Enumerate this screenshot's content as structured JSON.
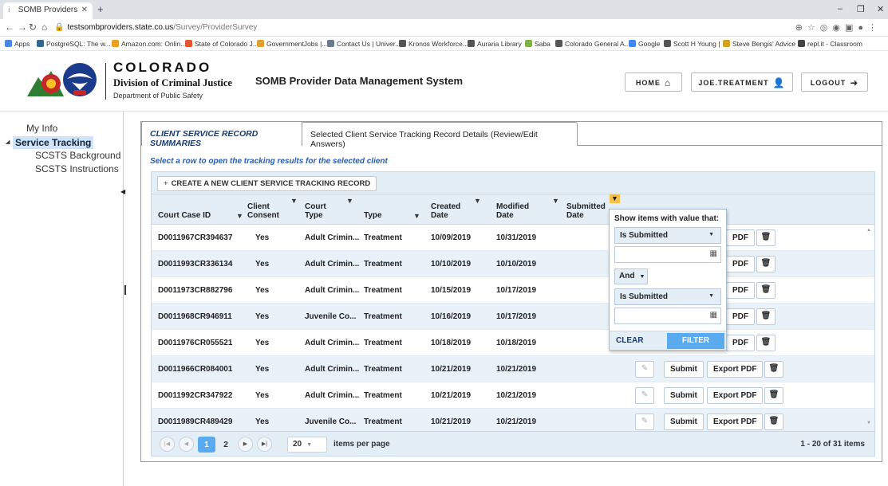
{
  "browser": {
    "tab_title": "SOMB Providers",
    "url_host": "testsombproviders.state.co.us",
    "url_path": "/Survey/ProviderSurvey",
    "bookmarks": [
      "Apps",
      "PostgreSQL: The w...",
      "Amazon.com: Onlin...",
      "State of Colorado J...",
      "GovernmentJobs |...",
      "Contact Us | Univer...",
      "Kronos Workforce...",
      "Auraria Library",
      "Saba",
      "Colorado General A...",
      "Google",
      "Scott H Young |",
      "Steve Bengis' Advice",
      "repl.it - Classroom"
    ]
  },
  "header": {
    "state": "COLORADO",
    "division": "Division of Criminal Justice",
    "department": "Department of Public Safety",
    "logo_text": "CDPS",
    "system_title": "SOMB Provider Data Management System",
    "home_label": "HOME",
    "user_label": "JOE.TREATMENT",
    "logout_label": "LOGOUT"
  },
  "sidebar": {
    "items": [
      "My Info",
      "Service Tracking",
      "SCSTS Background",
      "SCSTS Instructions"
    ]
  },
  "tabs": [
    "CLIENT SERVICE RECORD SUMMARIES",
    "Selected Client Service Tracking Record Details (Review/Edit Answers)"
  ],
  "instruction": "Select a row to open the tracking results for the selected client",
  "grid": {
    "create_label": "CREATE A NEW CLIENT SERVICE TRACKING RECORD",
    "columns": [
      "Court Case ID",
      "Client Consent",
      "Court Type",
      "Type",
      "Created Date",
      "Modified Date",
      "Submitted Date"
    ],
    "rows": [
      [
        "D0011967CR394637",
        "Yes",
        "Adult Crimin...",
        "Treatment",
        "10/09/2019",
        "10/31/2019"
      ],
      [
        "D0011993CR336134",
        "Yes",
        "Adult Crimin...",
        "Treatment",
        "10/10/2019",
        "10/10/2019"
      ],
      [
        "D0011973CR882796",
        "Yes",
        "Adult Crimin...",
        "Treatment",
        "10/15/2019",
        "10/17/2019"
      ],
      [
        "D0011968CR946911",
        "Yes",
        "Juvenile Co...",
        "Treatment",
        "10/16/2019",
        "10/17/2019"
      ],
      [
        "D0011976CR055521",
        "Yes",
        "Adult Crimin...",
        "Treatment",
        "10/18/2019",
        "10/18/2019"
      ],
      [
        "D0011966CR084001",
        "Yes",
        "Adult Crimin...",
        "Treatment",
        "10/21/2019",
        "10/21/2019"
      ],
      [
        "D0011992CR347922",
        "Yes",
        "Adult Crimin...",
        "Treatment",
        "10/21/2019",
        "10/21/2019"
      ],
      [
        "D0011989CR489429",
        "Yes",
        "Juvenile Co...",
        "Treatment",
        "10/21/2019",
        "10/21/2019"
      ]
    ],
    "actions": {
      "submit": "Submit",
      "export": "Export PDF",
      "pdf": "PDF"
    },
    "pager": {
      "pages": [
        "1",
        "2"
      ],
      "page_size": "20",
      "items_per_page": "items per page",
      "info": "1 - 20 of 31 items"
    }
  },
  "filter_popup": {
    "title": "Show items with value that:",
    "operator1": "Is Submitted",
    "logic": "And",
    "operator2": "Is Submitted",
    "clear_label": "CLEAR",
    "filter_label": "FILTER"
  }
}
